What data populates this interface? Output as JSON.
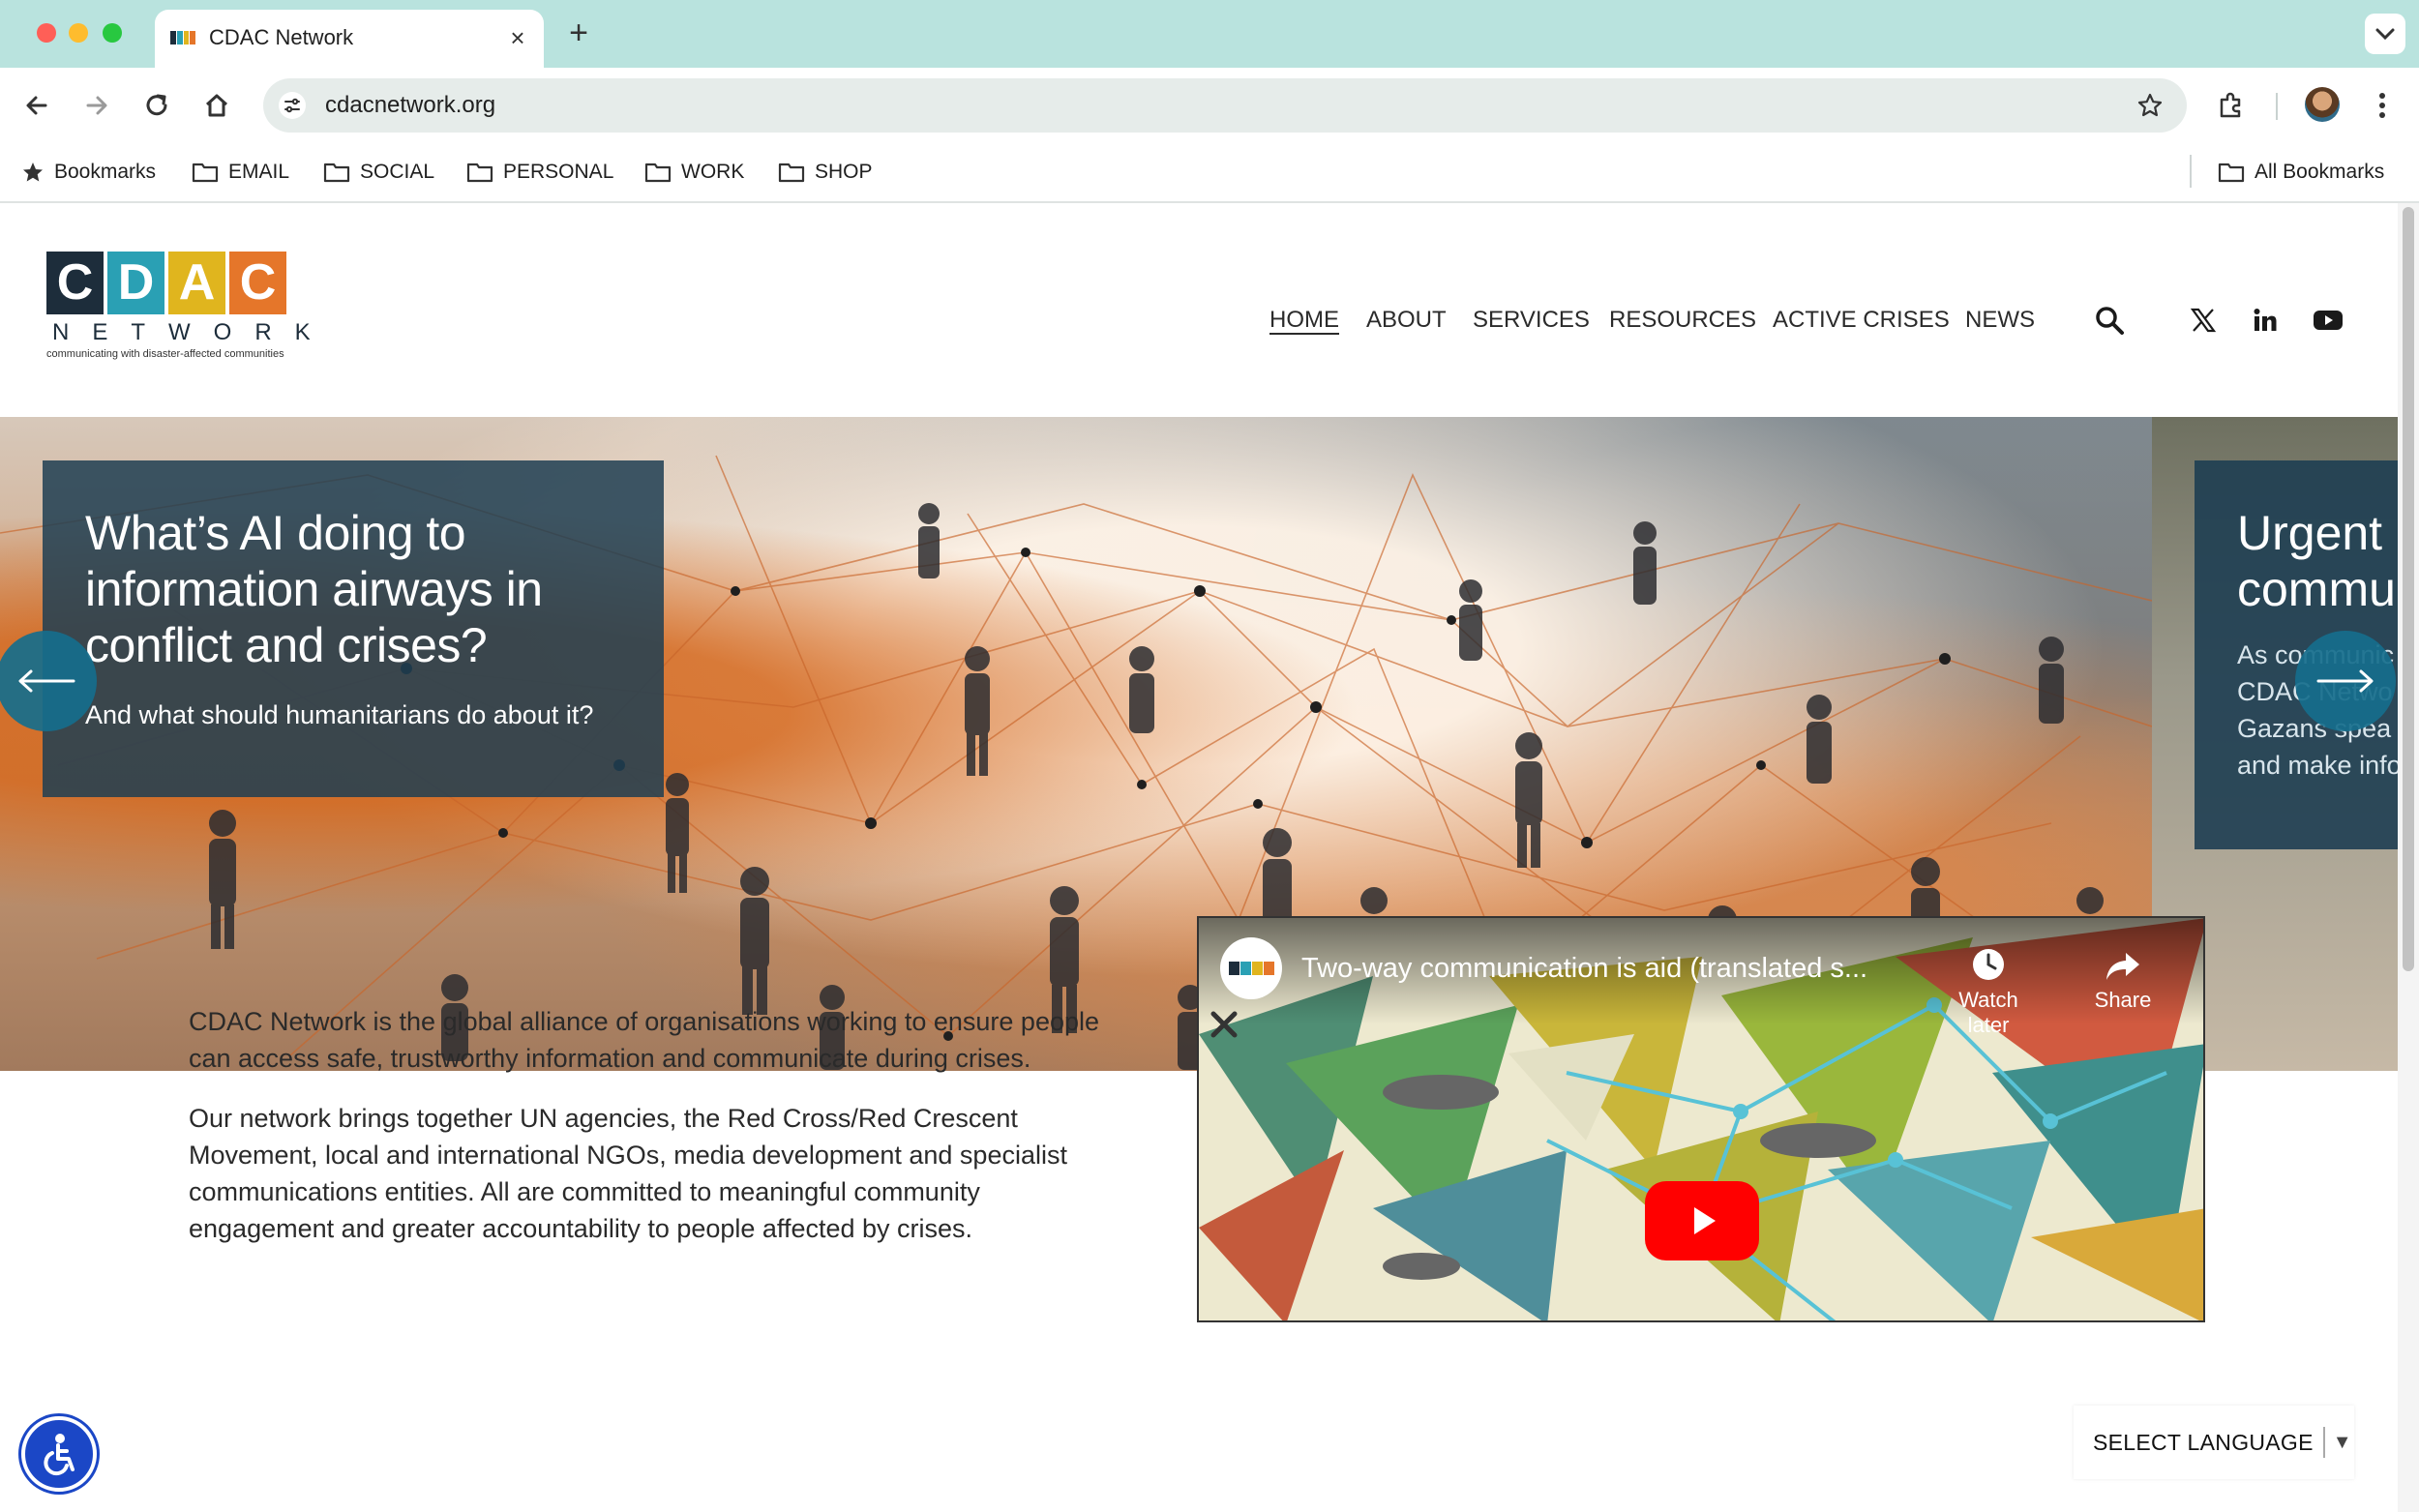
{
  "browser": {
    "tab_title": "CDAC Network",
    "url": "cdacnetwork.org",
    "bookmarks": [
      "Bookmarks",
      "EMAIL",
      "SOCIAL",
      "PERSONAL",
      "WORK",
      "SHOP"
    ],
    "all_bookmarks": "All Bookmarks"
  },
  "site": {
    "logo": {
      "letters": [
        "C",
        "D",
        "A",
        "C"
      ],
      "letter_colors": [
        "#1d2d3b",
        "#2aa0b4",
        "#e0b51e",
        "#e5762a"
      ],
      "network": "NETWORK",
      "tagline": "communicating with disaster-affected communities"
    },
    "nav": [
      "HOME",
      "ABOUT",
      "SERVICES",
      "RESOURCES",
      "ACTIVE CRISES",
      "NEWS"
    ],
    "active_nav": "HOME",
    "social_icons": [
      "x-icon",
      "linkedin-icon",
      "youtube-icon"
    ]
  },
  "hero": {
    "slide1": {
      "title": "What’s AI doing to information airways in conflict and crises?",
      "subtitle": "And what should humanitarians do about it?"
    },
    "slide2": {
      "title_lines": [
        "Urgent c",
        "commu"
      ],
      "body_lines": [
        "As communic",
        "CDAC Netwo",
        "Gazans spea",
        "and make info"
      ]
    }
  },
  "intro": {
    "p1": "CDAC Network is the global alliance of organisations working to ensure people can access safe, trustworthy information and communicate during crises.",
    "p2": "Our network brings together UN agencies, the Red Cross/Red Crescent Movement, local and international NGOs, media development and specialist communications entities. All are committed to meaningful community engagement and greater accountability to people affected by crises."
  },
  "video": {
    "title": "Two-way communication is aid (translated s...",
    "watch_later": "Watch later",
    "share": "Share"
  },
  "language": {
    "label": "SELECT LANGUAGE"
  },
  "colors": {
    "tab_strip": "#b9e3de",
    "caption_bg": "#1e3e52",
    "accent_teal": "#166e8c",
    "a11y_blue": "#1b47c6"
  }
}
